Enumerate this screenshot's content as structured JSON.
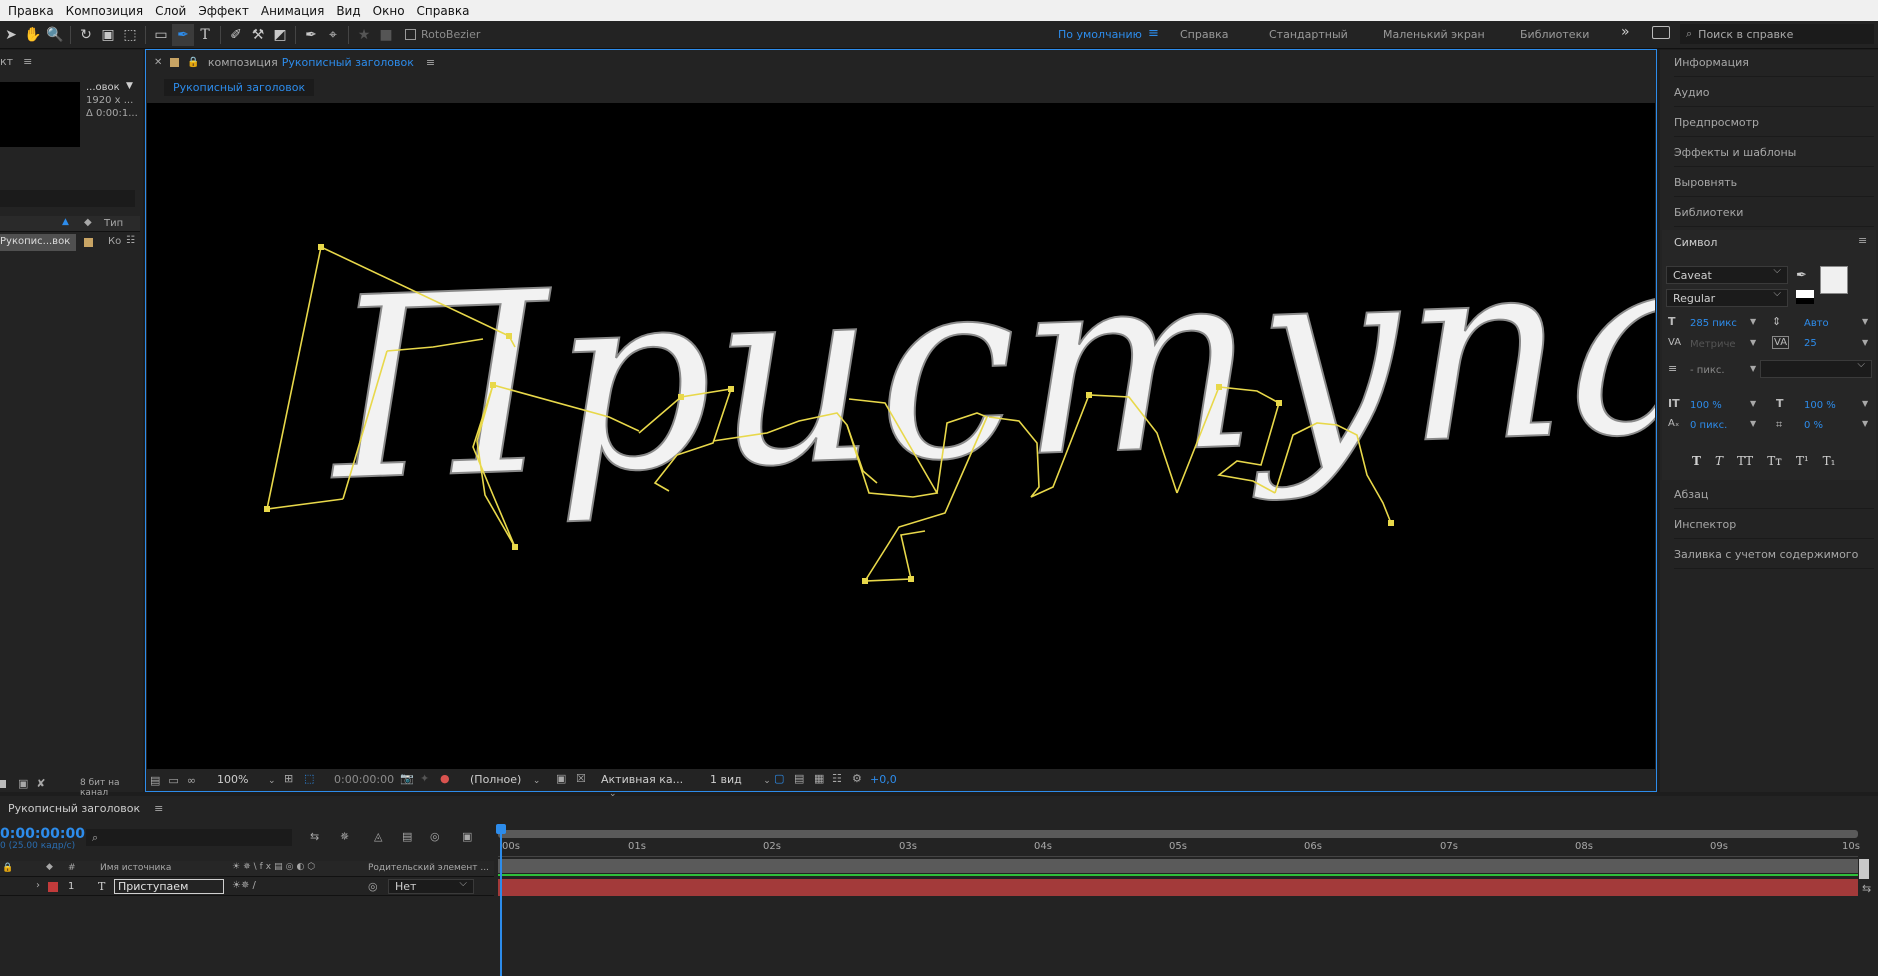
{
  "menu": [
    "Правка",
    "Композиция",
    "Слой",
    "Эффект",
    "Анимация",
    "Вид",
    "Окно",
    "Справка"
  ],
  "toolbar": {
    "rotobezier_label": "RotoBezier",
    "workspaces": [
      "По умолчанию",
      "Справка",
      "Стандартный",
      "Маленький экран",
      "Библиотеки"
    ],
    "search_placeholder": "Поиск в справке"
  },
  "project_panel": {
    "title": "кт",
    "comp_name": "...овок",
    "comp_size": "1920 x ...",
    "comp_dur": "Δ 0:00:1...",
    "col_type": "Тип",
    "item_name": "Рукопис...вок",
    "item_type": "Ко",
    "bit_depth": "8 бит на канал"
  },
  "comp_panel": {
    "tab_prefix": "композиция",
    "tab_name": "Рукописный заголовок",
    "flow_tab": "Рукописный заголовок",
    "zoom": "100%",
    "timecode": "0:00:00:00",
    "resolution": "(Полное)",
    "camera": "Активная ка...",
    "views": "1 вид",
    "exposure": "+0,0",
    "text": "Приступаем"
  },
  "right_panel": {
    "items_top": [
      "Информация",
      "Аудио",
      "Предпросмотр",
      "Эффекты и шаблоны",
      "Выровнять",
      "Библиотеки"
    ],
    "symbol_title": "Символ",
    "font_family": "Caveat",
    "font_style": "Regular",
    "font_size": "285 пикс",
    "leading": "Авто",
    "kerning": "Метриче",
    "tracking": "25",
    "stroke": "- пикс.",
    "vscale": "100 %",
    "hscale": "100 %",
    "baseline": "0 пикс.",
    "tsume": "0 %",
    "style_buttons": [
      "T",
      "T",
      "TT",
      "Tт",
      "T¹",
      "T₁"
    ],
    "items_bottom": [
      "Абзац",
      "Инспектор",
      "Заливка с учетом содержимого"
    ]
  },
  "timeline": {
    "title": "Рукописный заголовок",
    "timecode": "0:00:00:00",
    "fps": "0 (25.00 кадр/с)",
    "col_num": "#",
    "col_source": "Имя источника",
    "col_parent": "Родительский элемент ...",
    "layer_num": "1",
    "layer_name": "Приступаем",
    "parent_value": "Нет",
    "ruler": [
      "00s",
      "01s",
      "02s",
      "03s",
      "04s",
      "05s",
      "06s",
      "07s",
      "08s",
      "09s",
      "10s"
    ]
  },
  "colors": {
    "accent": "#2d8ceb",
    "path": "#e8d84a",
    "layer_bar": "#a33a3a",
    "label_red": "#c23b3b"
  }
}
